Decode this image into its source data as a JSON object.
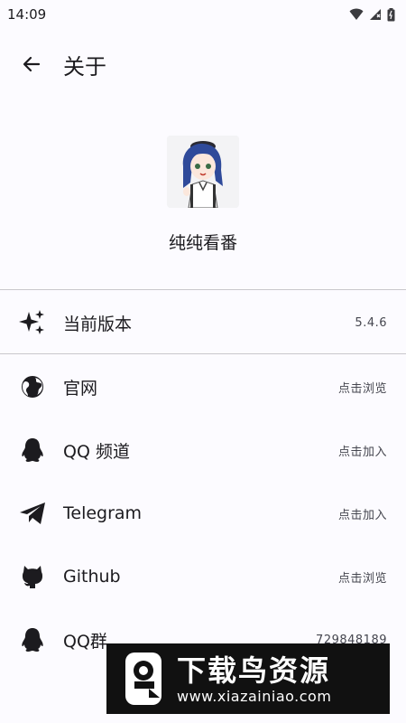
{
  "status_bar": {
    "time": "14:09"
  },
  "header": {
    "title": "关于"
  },
  "app": {
    "name": "纯纯看番"
  },
  "version_row": {
    "label": "当前版本",
    "value": "5.4.6",
    "icon": "sparkle-icon"
  },
  "links": [
    {
      "label": "官网",
      "value": "点击浏览",
      "icon": "globe-icon"
    },
    {
      "label": "QQ 频道",
      "value": "点击加入",
      "icon": "qq-icon"
    },
    {
      "label": "Telegram",
      "value": "点击加入",
      "icon": "telegram-icon"
    },
    {
      "label": "Github",
      "value": "点击浏览",
      "icon": "github-icon"
    },
    {
      "label": "QQ群",
      "value": "729848189",
      "icon": "qq-icon"
    }
  ],
  "watermark": {
    "title": "下载鸟资源",
    "url": "www.xiazainiao.com"
  },
  "colors": {
    "background": "#fcfbff",
    "divider": "#c9c7cc",
    "text": "#1c1b1f"
  }
}
